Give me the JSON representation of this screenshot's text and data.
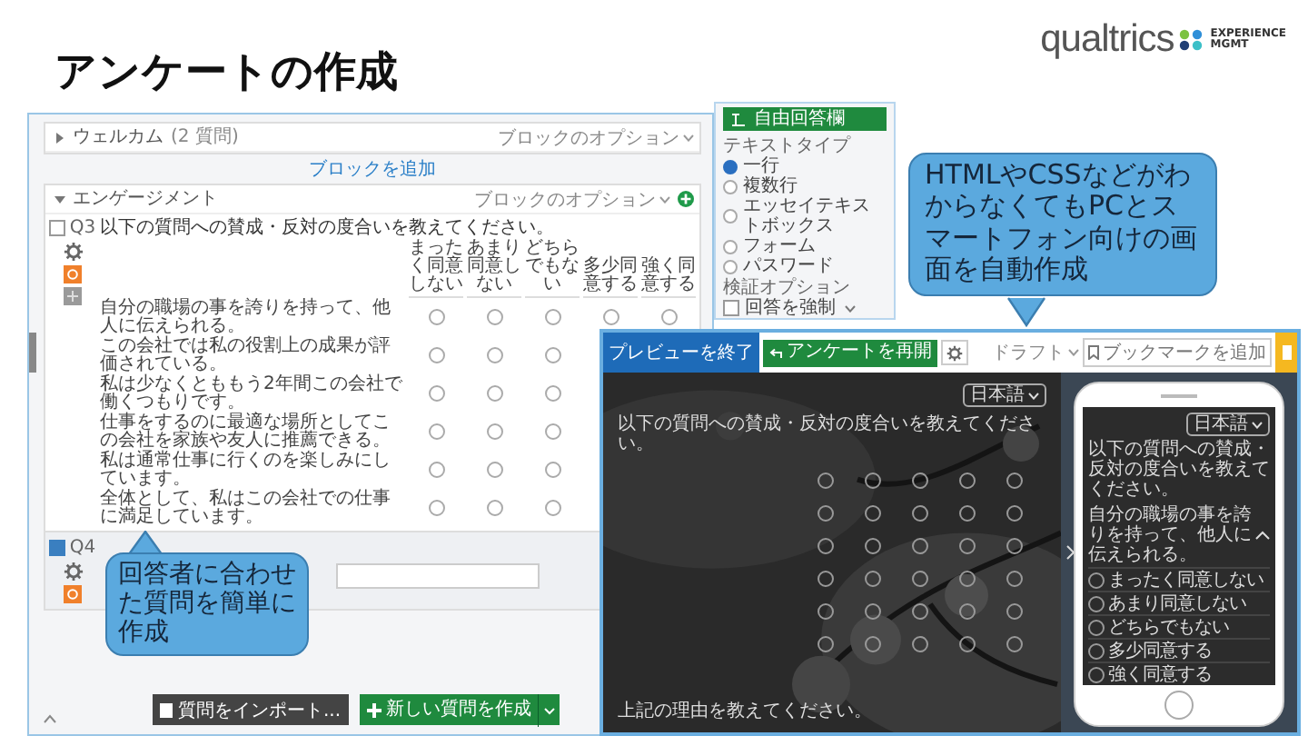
{
  "title": "アンケートの作成",
  "logo": {
    "wordmark": "qualtrics",
    "tagline": [
      "EXPERIENCE",
      "MGMT"
    ]
  },
  "editor": {
    "blocks": [
      {
        "title": "ウェルカム",
        "count": "(2 質問)",
        "options": "ブロックのオプション",
        "expanded": false
      },
      {
        "title": "エンゲージメント",
        "options": "ブロックのオプション",
        "expanded": true
      }
    ],
    "add_block": "ブロックを追加",
    "q3": {
      "number": "Q3",
      "selected": false,
      "text": "以下の質問への賛成・反対の度合いを教えてください。",
      "columns": [
        "まったく同意しない",
        "あまり同意しない",
        "どちらでもない",
        "多少同意する",
        "強く同意する"
      ],
      "rows": [
        {
          "text": "自分の職場の事を誇りを持って、他人に伝えられる。",
          "selected": [
            false,
            false,
            false,
            false,
            false
          ]
        },
        {
          "text": "この会社では私の役割上の成果が評価されている。",
          "selected": [
            false,
            false,
            false
          ]
        },
        {
          "text": "私は少なくとももう2年間この会社で働くつもりです。",
          "selected": [
            false,
            false,
            false
          ]
        },
        {
          "text": "仕事をするのに最適な場所としてこの会社を家族や友人に推薦できる。",
          "selected": [
            false,
            false,
            false
          ]
        },
        {
          "text": "私は通常仕事に行くのを楽しみにしています。",
          "selected": [
            false,
            false,
            false
          ]
        },
        {
          "text": "全体として、私はこの会社での仕事に満足しています。",
          "selected": [
            false,
            false,
            false
          ]
        }
      ]
    },
    "q4": {
      "number": "Q4",
      "selected": true
    },
    "import_button": "質問をインポート...",
    "create_button": "新しい質問を作成"
  },
  "sidebar": {
    "question_type": "自由回答欄",
    "text_type_label": "テキストタイプ",
    "text_types": [
      {
        "label": "一行",
        "selected": true
      },
      {
        "label": "複数行",
        "selected": false
      },
      {
        "label": "エッセイテキストボックス",
        "selected": false
      },
      {
        "label": "フォーム",
        "selected": false
      },
      {
        "label": "パスワード",
        "selected": false
      }
    ],
    "validation_label": "検証オプション",
    "force_response": {
      "label": "回答を強制",
      "checked": false
    }
  },
  "preview": {
    "exit": "プレビューを終了",
    "restart": "アンケートを再開",
    "status": "ドラフト",
    "bookmark": "ブックマークを追加",
    "language": "日本語",
    "question": "以下の質問への賛成・反対の度合いを教えてください。",
    "grid": [
      {
        "selected": [
          false,
          false,
          false,
          false,
          false
        ]
      },
      {
        "selected": [
          false,
          false,
          false,
          false,
          false
        ]
      },
      {
        "selected": [
          false,
          false,
          false,
          false,
          false
        ]
      },
      {
        "selected": [
          false,
          false,
          false,
          false,
          false
        ]
      },
      {
        "selected": [
          false,
          false,
          false,
          false,
          false
        ]
      },
      {
        "selected": [
          false,
          false,
          false,
          false,
          false
        ]
      }
    ],
    "footer_question": "上記の理由を教えてください。",
    "phone": {
      "language": "日本語",
      "question": "以下の質問への賛成・反対の度合いを教えてください。",
      "statement": "自分の職場の事を誇りを持って、他人に伝えられる。",
      "expanded": true,
      "options": [
        "まったく同意しない",
        "あまり同意しない",
        "どちらでもない",
        "多少同意する",
        "強く同意する"
      ]
    }
  },
  "callouts": [
    {
      "text": "HTMLやCSSなどがわからなくてもPCとスマートフォン向けの画面を自動作成"
    },
    {
      "text": "回答者に合わせた質問を簡単に作成"
    }
  ]
}
